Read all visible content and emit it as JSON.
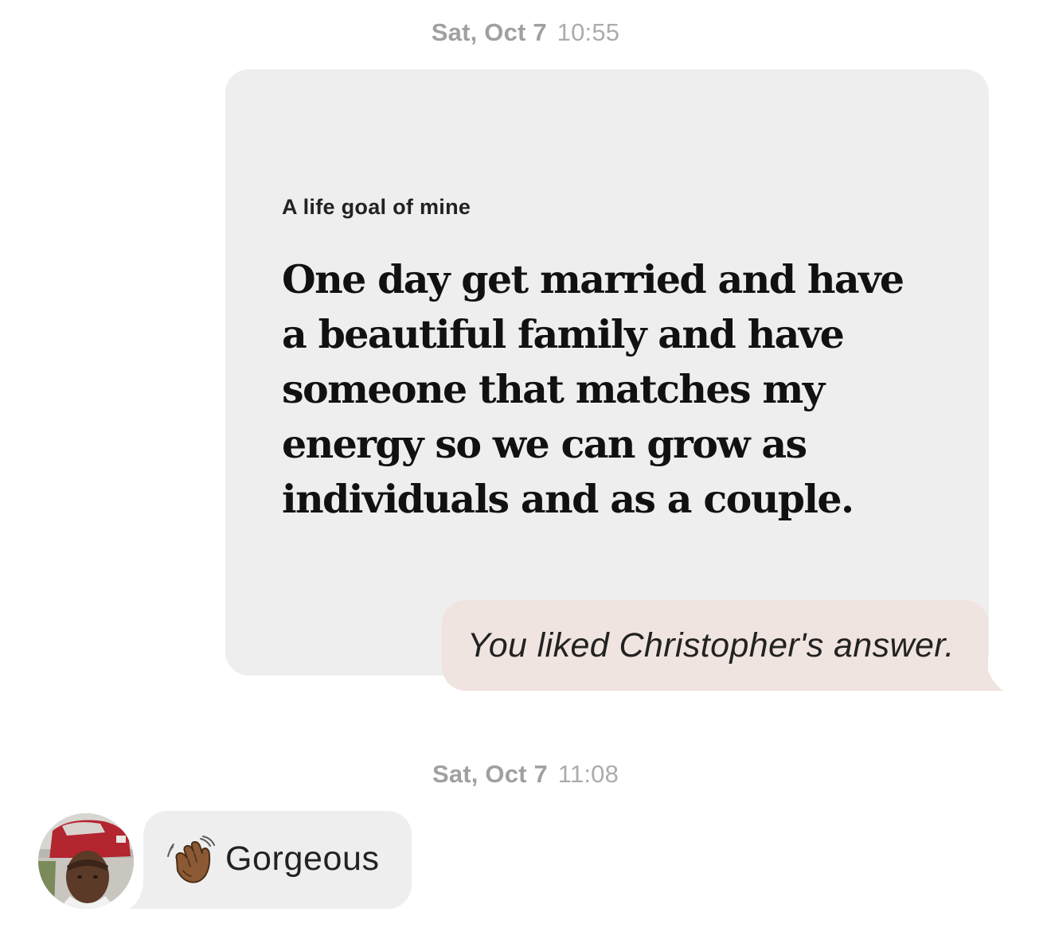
{
  "conversation": {
    "timestamp_1": {
      "date": "Sat, Oct 7",
      "time": "10:55"
    },
    "prompt_card": {
      "title": "A life goal of mine",
      "answer": "One day get married and have a beautiful family and have someone that matches my energy so we can grow as individuals and as a couple."
    },
    "like_message": {
      "text": "You liked Christopher's answer."
    },
    "timestamp_2": {
      "date": "Sat, Oct 7",
      "time": "11:08"
    },
    "incoming_message": {
      "emoji": "waving-hand-icon",
      "text": "Gorgeous"
    }
  },
  "colors": {
    "card_background": "#eeeeee",
    "like_bubble_background": "#efe4df",
    "timestamp_text": "#a3a3a3",
    "body_text": "#222222"
  }
}
